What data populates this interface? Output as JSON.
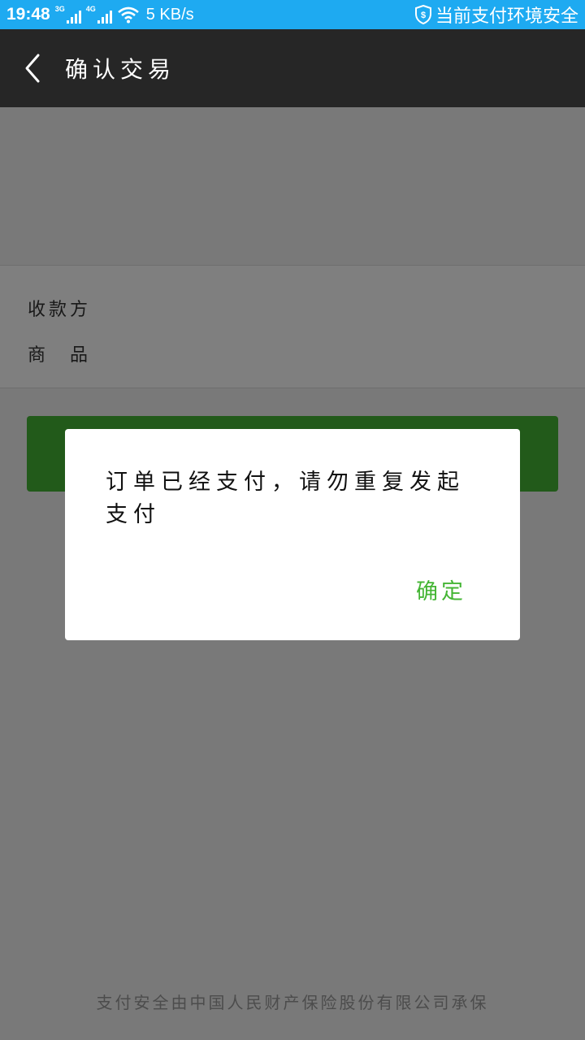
{
  "status_bar": {
    "time": "19:48",
    "network1": "3G",
    "network2": "4G",
    "speed": "5 KB/s",
    "security_text": "当前支付环境安全",
    "security_icon": "shield-icon"
  },
  "header": {
    "back_icon": "chevron-left-icon",
    "title": "确认交易"
  },
  "details": {
    "payee_label": "收款方",
    "product_label": "商　品"
  },
  "footer": {
    "note": "支付安全由中国人民财产保险股份有限公司承保"
  },
  "dialog": {
    "message": "订单已经支付，请勿重复发起支付",
    "ok_label": "确定"
  },
  "colors": {
    "status_bar": "#1eaaf1",
    "title_bar": "#262626",
    "accent_green": "#44b534"
  }
}
